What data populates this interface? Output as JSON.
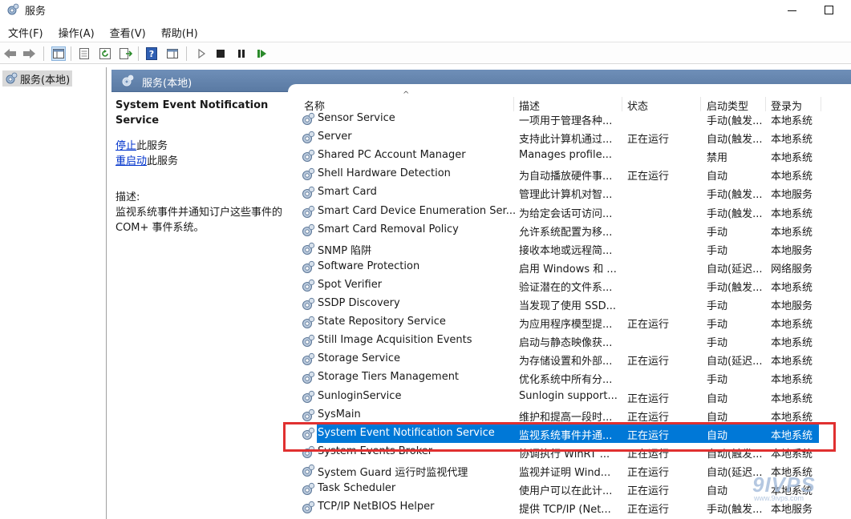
{
  "window": {
    "title": "服务",
    "icon": "services-gear-icon",
    "minimize": "minimize-icon",
    "maximize": "maximize-icon"
  },
  "menu": [
    "文件(F)",
    "操作(A)",
    "查看(V)",
    "帮助(H)"
  ],
  "toolbar": [
    "back-arrow-icon",
    "forward-arrow-icon",
    "show-hide-console-tree-icon",
    "properties-icon",
    "refresh-icon",
    "export-list-icon",
    "help-icon",
    "show-action-pane-icon",
    "play-icon",
    "stop-icon",
    "pause-icon",
    "restart-icon"
  ],
  "tree": {
    "root": "服务(本地)"
  },
  "pane": {
    "title": "服务(本地)"
  },
  "details": {
    "name_line1": "System Event Notification",
    "name_line2": "Service",
    "stop_link": "停止",
    "stop_suffix": "此服务",
    "restart_link": "重启动",
    "restart_suffix": "此服务",
    "desc_label": "描述:",
    "desc_line1": "监视系统事件并通知订户这些事件的",
    "desc_line2": "COM+ 事件系统。"
  },
  "columns": {
    "name": "名称",
    "desc": "描述",
    "state": "状态",
    "start": "启动类型",
    "logon": "登录为",
    "sort_glyph": "^"
  },
  "rows": [
    {
      "name": "Sensor Service",
      "desc": "一项用于管理各种...",
      "state": "",
      "start": "手动(触发...",
      "logon": "本地系统"
    },
    {
      "name": "Server",
      "desc": "支持此计算机通过...",
      "state": "正在运行",
      "start": "自动(触发...",
      "logon": "本地系统"
    },
    {
      "name": "Shared PC Account Manager",
      "desc": "Manages profile...",
      "state": "",
      "start": "禁用",
      "logon": "本地系统"
    },
    {
      "name": "Shell Hardware Detection",
      "desc": "为自动播放硬件事...",
      "state": "正在运行",
      "start": "自动",
      "logon": "本地系统"
    },
    {
      "name": "Smart Card",
      "desc": "管理此计算机对智...",
      "state": "",
      "start": "手动(触发...",
      "logon": "本地服务"
    },
    {
      "name": "Smart Card Device Enumeration Ser...",
      "desc": "为给定会话可访问...",
      "state": "",
      "start": "手动(触发...",
      "logon": "本地系统"
    },
    {
      "name": "Smart Card Removal Policy",
      "desc": "允许系统配置为移...",
      "state": "",
      "start": "手动",
      "logon": "本地系统"
    },
    {
      "name": "SNMP 陷阱",
      "desc": "接收本地或远程简...",
      "state": "",
      "start": "手动",
      "logon": "本地服务"
    },
    {
      "name": "Software Protection",
      "desc": "启用 Windows 和 ...",
      "state": "",
      "start": "自动(延迟...",
      "logon": "网络服务"
    },
    {
      "name": "Spot Verifier",
      "desc": "验证潜在的文件系...",
      "state": "",
      "start": "手动(触发...",
      "logon": "本地系统"
    },
    {
      "name": "SSDP Discovery",
      "desc": "当发现了使用 SSD...",
      "state": "",
      "start": "手动",
      "logon": "本地服务"
    },
    {
      "name": "State Repository Service",
      "desc": "为应用程序模型提...",
      "state": "正在运行",
      "start": "手动",
      "logon": "本地系统"
    },
    {
      "name": "Still Image Acquisition Events",
      "desc": "启动与静态映像获...",
      "state": "",
      "start": "手动",
      "logon": "本地系统"
    },
    {
      "name": "Storage Service",
      "desc": "为存储设置和外部...",
      "state": "正在运行",
      "start": "自动(延迟...",
      "logon": "本地系统"
    },
    {
      "name": "Storage Tiers Management",
      "desc": "优化系统中所有分...",
      "state": "",
      "start": "手动",
      "logon": "本地系统"
    },
    {
      "name": "SunloginService",
      "desc": "Sunlogin support...",
      "state": "正在运行",
      "start": "自动",
      "logon": "本地系统"
    },
    {
      "name": "SysMain",
      "desc": "维护和提高一段时...",
      "state": "正在运行",
      "start": "自动",
      "logon": "本地系统"
    },
    {
      "name": "System Event Notification Service",
      "desc": "监视系统事件并通...",
      "state": "正在运行",
      "start": "自动",
      "logon": "本地系统",
      "selected": true
    },
    {
      "name": "System Events Broker",
      "desc": "协调执行 WinRT ...",
      "state": "正在运行",
      "start": "自动(触发...",
      "logon": "本地系统"
    },
    {
      "name": "System Guard 运行时监视代理",
      "desc": "监视并证明 Wind...",
      "state": "正在运行",
      "start": "自动(延迟...",
      "logon": "本地系统"
    },
    {
      "name": "Task Scheduler",
      "desc": "使用户可以在此计...",
      "state": "正在运行",
      "start": "自动",
      "logon": "本地系统"
    },
    {
      "name": "TCP/IP NetBIOS Helper",
      "desc": "提供 TCP/IP (Net...",
      "state": "正在运行",
      "start": "手动(触发...",
      "logon": "本地服务"
    }
  ],
  "watermark": {
    "text": "9IVPS",
    "sub": "www.9ivps.com"
  },
  "colors": {
    "selection": "#0078d7",
    "highlight_box": "#e03030",
    "header_bar": "#6f8fb8",
    "link": "#0033cc"
  }
}
